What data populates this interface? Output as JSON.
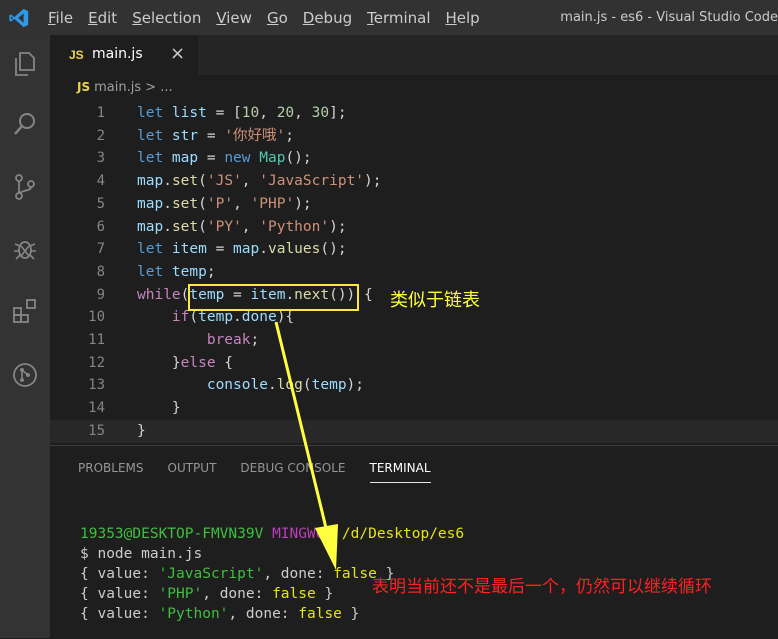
{
  "titlebar": {
    "menu": [
      "File",
      "Edit",
      "Selection",
      "View",
      "Go",
      "Debug",
      "Terminal",
      "Help"
    ],
    "window_title": "main.js - es6 - Visual Studio Code"
  },
  "tab": {
    "badge": "JS",
    "name": "main.js",
    "close": "×"
  },
  "breadcrumb": {
    "badge": "JS",
    "text": "main.js > ..."
  },
  "code_lines": [
    {
      "n": "1",
      "tokens": [
        [
          "kb",
          "let "
        ],
        [
          "v",
          "list"
        ],
        [
          "p",
          " = ["
        ],
        [
          "n",
          "10"
        ],
        [
          "p",
          ", "
        ],
        [
          "n",
          "20"
        ],
        [
          "p",
          ", "
        ],
        [
          "n",
          "30"
        ],
        [
          "p",
          "];"
        ]
      ]
    },
    {
      "n": "2",
      "tokens": [
        [
          "kb",
          "let "
        ],
        [
          "v",
          "str"
        ],
        [
          "p",
          " = "
        ],
        [
          "s",
          "'你好哦'"
        ],
        [
          "p",
          ";"
        ]
      ]
    },
    {
      "n": "3",
      "tokens": [
        [
          "kb",
          "let "
        ],
        [
          "v",
          "map"
        ],
        [
          "p",
          " = "
        ],
        [
          "kb",
          "new "
        ],
        [
          "t",
          "Map"
        ],
        [
          "p",
          "();"
        ]
      ]
    },
    {
      "n": "4",
      "tokens": [
        [
          "v",
          "map"
        ],
        [
          "p",
          "."
        ],
        [
          "f",
          "set"
        ],
        [
          "p",
          "("
        ],
        [
          "s",
          "'JS'"
        ],
        [
          "p",
          ", "
        ],
        [
          "s",
          "'JavaScript'"
        ],
        [
          "p",
          ");"
        ]
      ]
    },
    {
      "n": "5",
      "tokens": [
        [
          "v",
          "map"
        ],
        [
          "p",
          "."
        ],
        [
          "f",
          "set"
        ],
        [
          "p",
          "("
        ],
        [
          "s",
          "'P'"
        ],
        [
          "p",
          ", "
        ],
        [
          "s",
          "'PHP'"
        ],
        [
          "p",
          ");"
        ]
      ]
    },
    {
      "n": "6",
      "tokens": [
        [
          "v",
          "map"
        ],
        [
          "p",
          "."
        ],
        [
          "f",
          "set"
        ],
        [
          "p",
          "("
        ],
        [
          "s",
          "'PY'"
        ],
        [
          "p",
          ", "
        ],
        [
          "s",
          "'Python'"
        ],
        [
          "p",
          ");"
        ]
      ]
    },
    {
      "n": "7",
      "tokens": [
        [
          "kb",
          "let "
        ],
        [
          "v",
          "item"
        ],
        [
          "p",
          " = "
        ],
        [
          "v",
          "map"
        ],
        [
          "p",
          "."
        ],
        [
          "f",
          "values"
        ],
        [
          "p",
          "();"
        ]
      ]
    },
    {
      "n": "8",
      "tokens": [
        [
          "kb",
          "let "
        ],
        [
          "v",
          "temp"
        ],
        [
          "p",
          ";"
        ]
      ]
    },
    {
      "n": "9",
      "tokens": [
        [
          "k",
          "while"
        ],
        [
          "p",
          "("
        ],
        [
          "v",
          "temp"
        ],
        [
          "p",
          " = "
        ],
        [
          "v",
          "item"
        ],
        [
          "p",
          "."
        ],
        [
          "f",
          "next"
        ],
        [
          "p",
          "()) {"
        ]
      ]
    },
    {
      "n": "10",
      "tokens": [
        [
          "p",
          "    "
        ],
        [
          "k",
          "if"
        ],
        [
          "p",
          "("
        ],
        [
          "v",
          "temp"
        ],
        [
          "p",
          "."
        ],
        [
          "v",
          "done"
        ],
        [
          "p",
          "){"
        ]
      ]
    },
    {
      "n": "11",
      "tokens": [
        [
          "p",
          "        "
        ],
        [
          "k",
          "break"
        ],
        [
          "p",
          ";"
        ]
      ]
    },
    {
      "n": "12",
      "tokens": [
        [
          "p",
          "    "
        ],
        [
          "p",
          "}"
        ],
        [
          "k",
          "else"
        ],
        [
          "p",
          " {"
        ]
      ]
    },
    {
      "n": "13",
      "tokens": [
        [
          "p",
          "        "
        ],
        [
          "v",
          "console"
        ],
        [
          "p",
          "."
        ],
        [
          "f",
          "log"
        ],
        [
          "p",
          "("
        ],
        [
          "v",
          "temp"
        ],
        [
          "p",
          ");"
        ]
      ]
    },
    {
      "n": "14",
      "tokens": [
        [
          "p",
          "    "
        ],
        [
          "p",
          "}"
        ]
      ]
    },
    {
      "n": "15",
      "tokens": [
        [
          "p",
          "}"
        ]
      ]
    }
  ],
  "annotation_top": "类似于链表",
  "panel": {
    "tabs": [
      "PROBLEMS",
      "OUTPUT",
      "DEBUG CONSOLE",
      "TERMINAL"
    ],
    "active_tab": "TERMINAL"
  },
  "terminal": {
    "prompt_user": "19353@DESKTOP-FMVN39V",
    "prompt_env": "MINGW64",
    "prompt_path": "/d/Desktop/es6",
    "command": "$ node main.js",
    "outputs": [
      {
        "value": "'JavaScript'",
        "done": "false"
      },
      {
        "value": "'PHP'",
        "done": "false"
      },
      {
        "value": "'Python'",
        "done": "false"
      }
    ]
  },
  "annotation_bottom": "表明当前还不是最后一个，仍然可以继续循环",
  "colors": {
    "highlight_box": "#ffe640",
    "arrow": "#ffff40",
    "annotation_red": "#ff2020"
  }
}
